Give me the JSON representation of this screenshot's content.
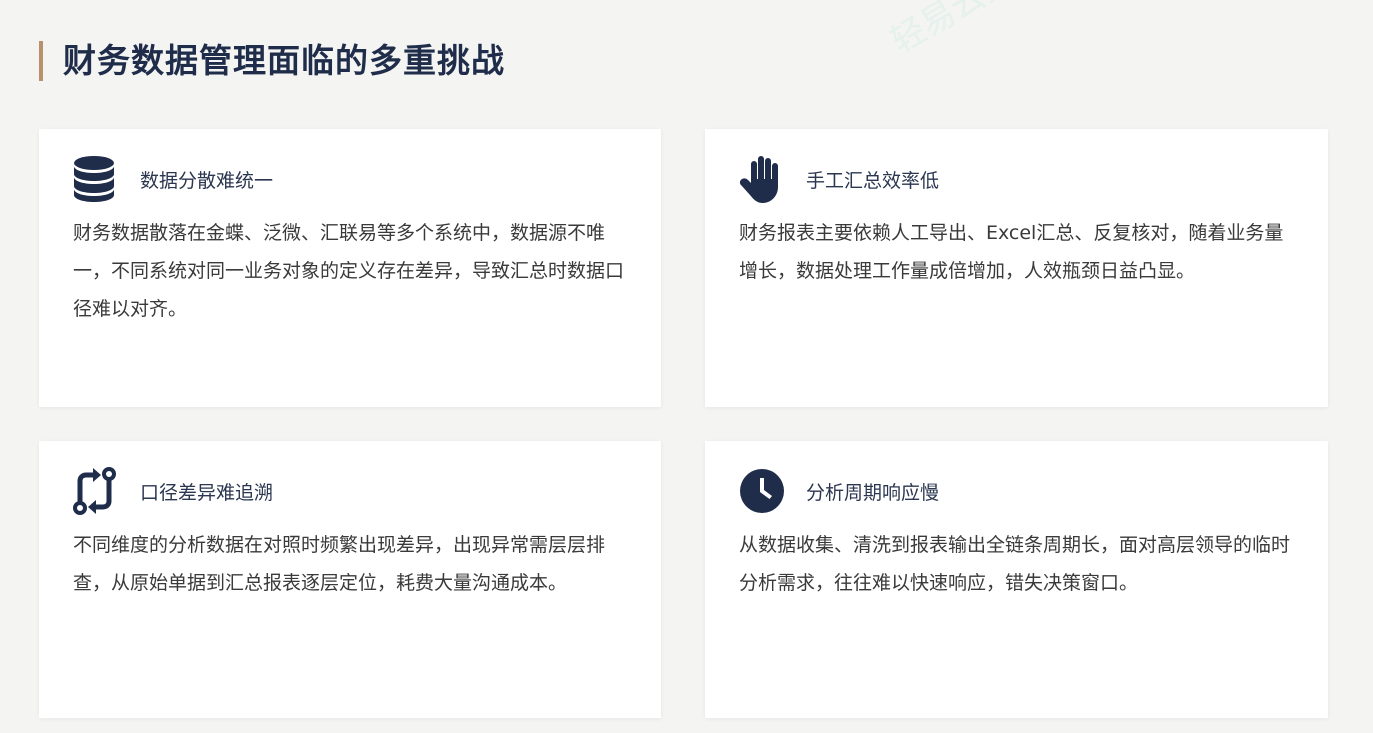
{
  "page": {
    "title": "财务数据管理面临的多重挑战",
    "watermark": "轻易云数据集成平台"
  },
  "cards": [
    {
      "icon": "database-icon",
      "title": "数据分散难统一",
      "text": "财务数据散落在金蝶、泛微、汇联易等多个系统中，数据源不唯一，不同系统对同一业务对象的定义存在差异，导致汇总时数据口径难以对齐。"
    },
    {
      "icon": "hand-icon",
      "title": "手工汇总效率低",
      "text": "财务报表主要依赖人工导出、Excel汇总、反复核对，随着业务量增长，数据处理工作量成倍增加，人效瓶颈日益凸显。"
    },
    {
      "icon": "git-compare-icon",
      "title": "口径差异难追溯",
      "text": "不同维度的分析数据在对照时频繁出现差异，出现异常需层层排查，从原始单据到汇总报表逐层定位，耗费大量沟通成本。"
    },
    {
      "icon": "clock-icon",
      "title": "分析周期响应慢",
      "text": "从数据收集、清洗到报表输出全链条周期长，面对高层领导的临时分析需求，往往难以快速响应，错失决策窗口。"
    }
  ],
  "colors": {
    "accent": "#b8916a",
    "icon": "#1f2d4b",
    "background": "#f4f4f2",
    "card": "#ffffff"
  }
}
